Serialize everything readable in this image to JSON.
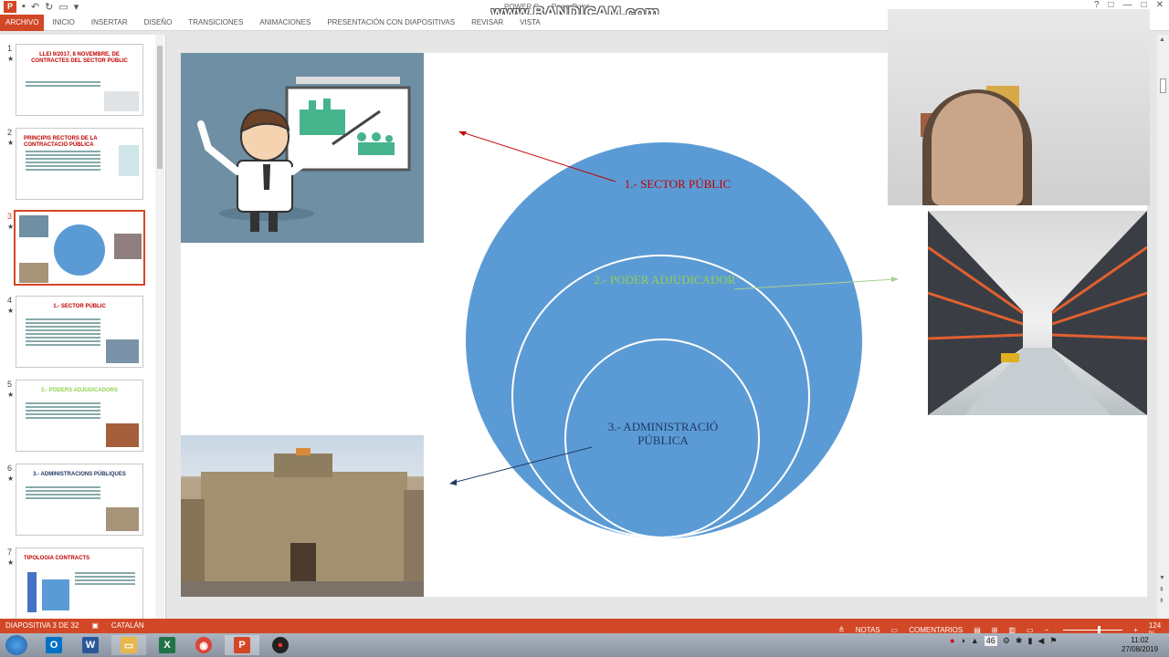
{
  "window": {
    "title": "POWER C... - PowerPoint",
    "watermark": "www.BANDICAM.com",
    "controls": [
      "?",
      "□",
      "—",
      "□",
      "✕"
    ]
  },
  "ribbon": {
    "tabs": [
      "ARCHIVO",
      "INICIO",
      "INSERTAR",
      "DISEÑO",
      "TRANSICIONES",
      "ANIMACIONES",
      "PRESENTACIÓN CON DIAPOSITIVAS",
      "REVISAR",
      "VISTA"
    ]
  },
  "thumbnails": [
    {
      "num": "1",
      "title": "LLEI 9/2017, 8 NOVEMBRE, DE CONTRACTES DEL SECTOR PÚBLIC"
    },
    {
      "num": "2",
      "title": "PRINCIPIS RECTORS DE LA CONTRACTACIÓ PÚBLICA"
    },
    {
      "num": "3",
      "title": ""
    },
    {
      "num": "4",
      "title": "1.- SECTOR PÚBLIC"
    },
    {
      "num": "5",
      "title": "2.- PODERS ADJUDICADORS"
    },
    {
      "num": "6",
      "title": "3.- ADMINISTRACIONS PÚBLIQUES"
    },
    {
      "num": "7",
      "title": "TIPOLOGIA CONTRACTS"
    }
  ],
  "slide": {
    "label_sector": "1.- SECTOR PÚBLIC",
    "label_poder": "2.- PODER ADJUDICADOR",
    "label_admin": "3.- ADMINISTRACIÓ PÚBLICA"
  },
  "status": {
    "slide_info": "DIAPOSITIVA 3 DE 32",
    "language": "CATALÁN",
    "notes": "NOTAS",
    "comments": "COMENTARIOS",
    "zoom": "124 %"
  },
  "taskbar": {
    "apps": [
      {
        "name": "outlook",
        "glyph": "O",
        "color": "#0072c6"
      },
      {
        "name": "word",
        "glyph": "W",
        "color": "#2b579a"
      },
      {
        "name": "explorer",
        "glyph": "▭",
        "color": "#e8b84a"
      },
      {
        "name": "excel",
        "glyph": "X",
        "color": "#217346"
      },
      {
        "name": "chrome",
        "glyph": "◉",
        "color": "#db4437"
      },
      {
        "name": "powerpoint",
        "glyph": "P",
        "color": "#d24726"
      },
      {
        "name": "bandicam",
        "glyph": "●",
        "color": "#222222"
      }
    ],
    "tray_badge": "46",
    "time": "11:02",
    "date": "27/08/2019"
  }
}
